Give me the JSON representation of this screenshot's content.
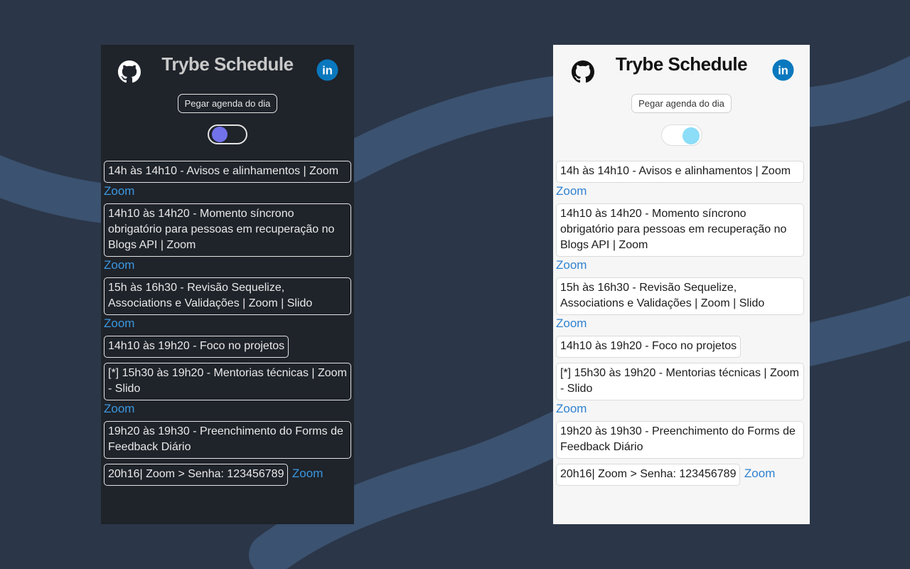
{
  "colors": {
    "page_bg": "#2b3648",
    "wave": "#3b5270",
    "dark_panel_bg": "#1f232a",
    "light_panel_bg": "#f6f6f6",
    "link": "#3a97e0",
    "dark_knob": "#7272ea",
    "light_knob": "#8bddf8",
    "linkedin": "#0a78be"
  },
  "icons": {
    "github": "github-icon",
    "linkedin": "linkedin-icon"
  },
  "app": {
    "title": "Trybe Schedule",
    "get_button": "Pegar agenda do dia",
    "linkedin_label": "in"
  },
  "dark_theme": {
    "events": [
      {
        "text": "14h às 14h10 -  Avisos e alinhamentos | Zoom",
        "link": "Zoom"
      },
      {
        "text": "14h10 às 14h20 - Momento síncrono obrigatório para pessoas em recuperação no Blogs API | Zoom",
        "link": "Zoom"
      },
      {
        "text": "15h às 16h30 - Revisão Sequelize, Associations e Validações | Zoom | Slido",
        "link": "Zoom"
      },
      {
        "text": "14h10 às 19h20 - Foco no projetos"
      },
      {
        "text": "[*] 15h30 às 19h20 - Mentorias técnicas | Zoom - Slido",
        "link": "Zoom"
      },
      {
        "text": "19h20 às 19h30 - Preenchimento do Forms de Feedback Diário"
      },
      {
        "text": "20h16| Zoom > Senha: 123456789",
        "link": "Zoom"
      }
    ]
  },
  "light_theme": {
    "events": [
      {
        "text": "14h às 14h10 -  Avisos e alinhamentos | Zoom",
        "link": "Zoom"
      },
      {
        "text": "14h10 às 14h20 - Momento síncrono obrigatório para pessoas em recuperação no Blogs API | Zoom",
        "link": "Zoom"
      },
      {
        "text": "15h às 16h30 - Revisão Sequelize, Associations e Validações | Zoom | Slido",
        "link": "Zoom"
      },
      {
        "text": "14h10 às 19h20 - Foco no projetos"
      },
      {
        "text": "[*] 15h30 às 19h20 - Mentorias técnicas | Zoom - Slido",
        "link": "Zoom"
      },
      {
        "text": "19h20 às 19h30 - Preenchimento do Forms de Feedback Diário"
      },
      {
        "text": "20h16| Zoom > Senha: 123456789",
        "link": "Zoom"
      }
    ]
  }
}
